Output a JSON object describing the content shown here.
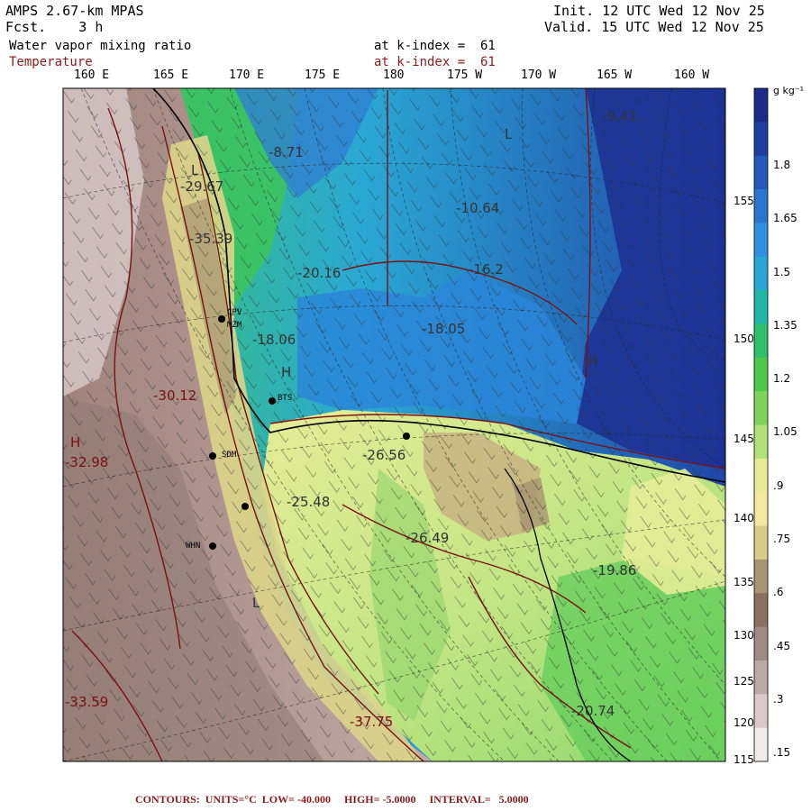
{
  "header": {
    "model": "AMPS 2.67-km MPAS",
    "fcst_label": "Fcst.",
    "fcst_value": "3 h",
    "init": "Init. 12 UTC Wed 12 Nov 25",
    "valid": "Valid. 15 UTC Wed 12 Nov 25",
    "field1": "Water vapor mixing ratio",
    "field1_level": "at k-index =  61",
    "field2": "Temperature",
    "field2_level": "at k-index =  61"
  },
  "longitude_labels": [
    "160 E",
    "165 E",
    "170 E",
    "175 E",
    "180",
    "175 W",
    "170 W",
    "165 W",
    "160 W"
  ],
  "latitude_labels": [
    "155",
    "150",
    "145",
    "140",
    "135",
    "130",
    "125",
    "120",
    "115"
  ],
  "colorbar": {
    "units": "g kg⁻¹",
    "ticks": [
      "1.8",
      "1.65",
      "1.5",
      "1.35",
      "1.2",
      "1.05",
      ".9",
      ".75",
      ".6",
      ".45",
      ".3",
      ".15"
    ],
    "colors": [
      "#1c2a8a",
      "#1f3f9e",
      "#2359b8",
      "#2a76cf",
      "#2f8fe0",
      "#2aa6d6",
      "#1fb8a8",
      "#2ebf6a",
      "#4cc94a",
      "#7ed45a",
      "#b2e07a",
      "#e6ec96",
      "#f3eaa0",
      "#d9cc86",
      "#a89470",
      "#8a7060",
      "#a08a84",
      "#bca8a6",
      "#d8caca",
      "#f0eaea"
    ]
  },
  "map_labels": [
    "-9.41",
    "-16.2",
    "-18.05",
    "-18.06",
    "-20.16",
    "-26.56",
    "-25.48",
    "-26.49",
    "-19.86",
    "-20.74",
    "-10.64",
    "-8.71",
    "-30.12",
    "-32.98",
    "-33.59",
    "-29.67",
    "-35.39",
    "-37.75",
    "H",
    "H",
    "L",
    "L",
    "L",
    "H"
  ],
  "stations": [
    "CPV",
    "MZM",
    "BTS",
    "SDM",
    "WHN"
  ],
  "footer": "CONTOURS:  UNITS=°C  LOW= -40.000     HIGH= -5.0000     INTERVAL=   5.0000"
}
